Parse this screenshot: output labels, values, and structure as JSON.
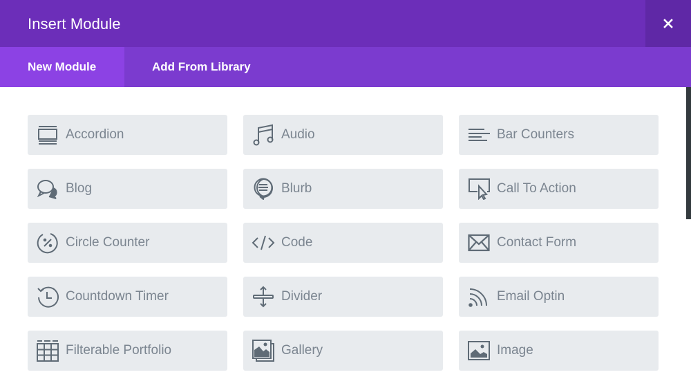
{
  "header": {
    "title": "Insert Module",
    "close_icon": "close-icon"
  },
  "tabs": [
    {
      "label": "New Module",
      "active": true
    },
    {
      "label": "Add From Library",
      "active": false
    }
  ],
  "modules": [
    {
      "label": "Accordion",
      "icon": "accordion-icon"
    },
    {
      "label": "Audio",
      "icon": "music-note-icon"
    },
    {
      "label": "Bar Counters",
      "icon": "bar-lines-icon"
    },
    {
      "label": "Blog",
      "icon": "chat-bubbles-icon"
    },
    {
      "label": "Blurb",
      "icon": "speech-bubble-lines-icon"
    },
    {
      "label": "Call To Action",
      "icon": "screen-cursor-icon"
    },
    {
      "label": "Circle Counter",
      "icon": "circle-percent-icon"
    },
    {
      "label": "Code",
      "icon": "code-icon"
    },
    {
      "label": "Contact Form",
      "icon": "envelope-icon"
    },
    {
      "label": "Countdown Timer",
      "icon": "clock-history-icon"
    },
    {
      "label": "Divider",
      "icon": "divider-arrows-icon"
    },
    {
      "label": "Email Optin",
      "icon": "rss-icon"
    },
    {
      "label": "Filterable Portfolio",
      "icon": "grid-table-icon"
    },
    {
      "label": "Gallery",
      "icon": "gallery-icon"
    },
    {
      "label": "Image",
      "icon": "image-icon"
    }
  ],
  "colors": {
    "header_bg": "#6c2eb9",
    "tabs_bg": "#7b3bcf",
    "active_tab_bg": "#8c42e4",
    "close_bg": "#5f28a6",
    "module_bg": "#e8ebee",
    "module_text": "#7b8590",
    "icon_color": "#5f6b76"
  }
}
